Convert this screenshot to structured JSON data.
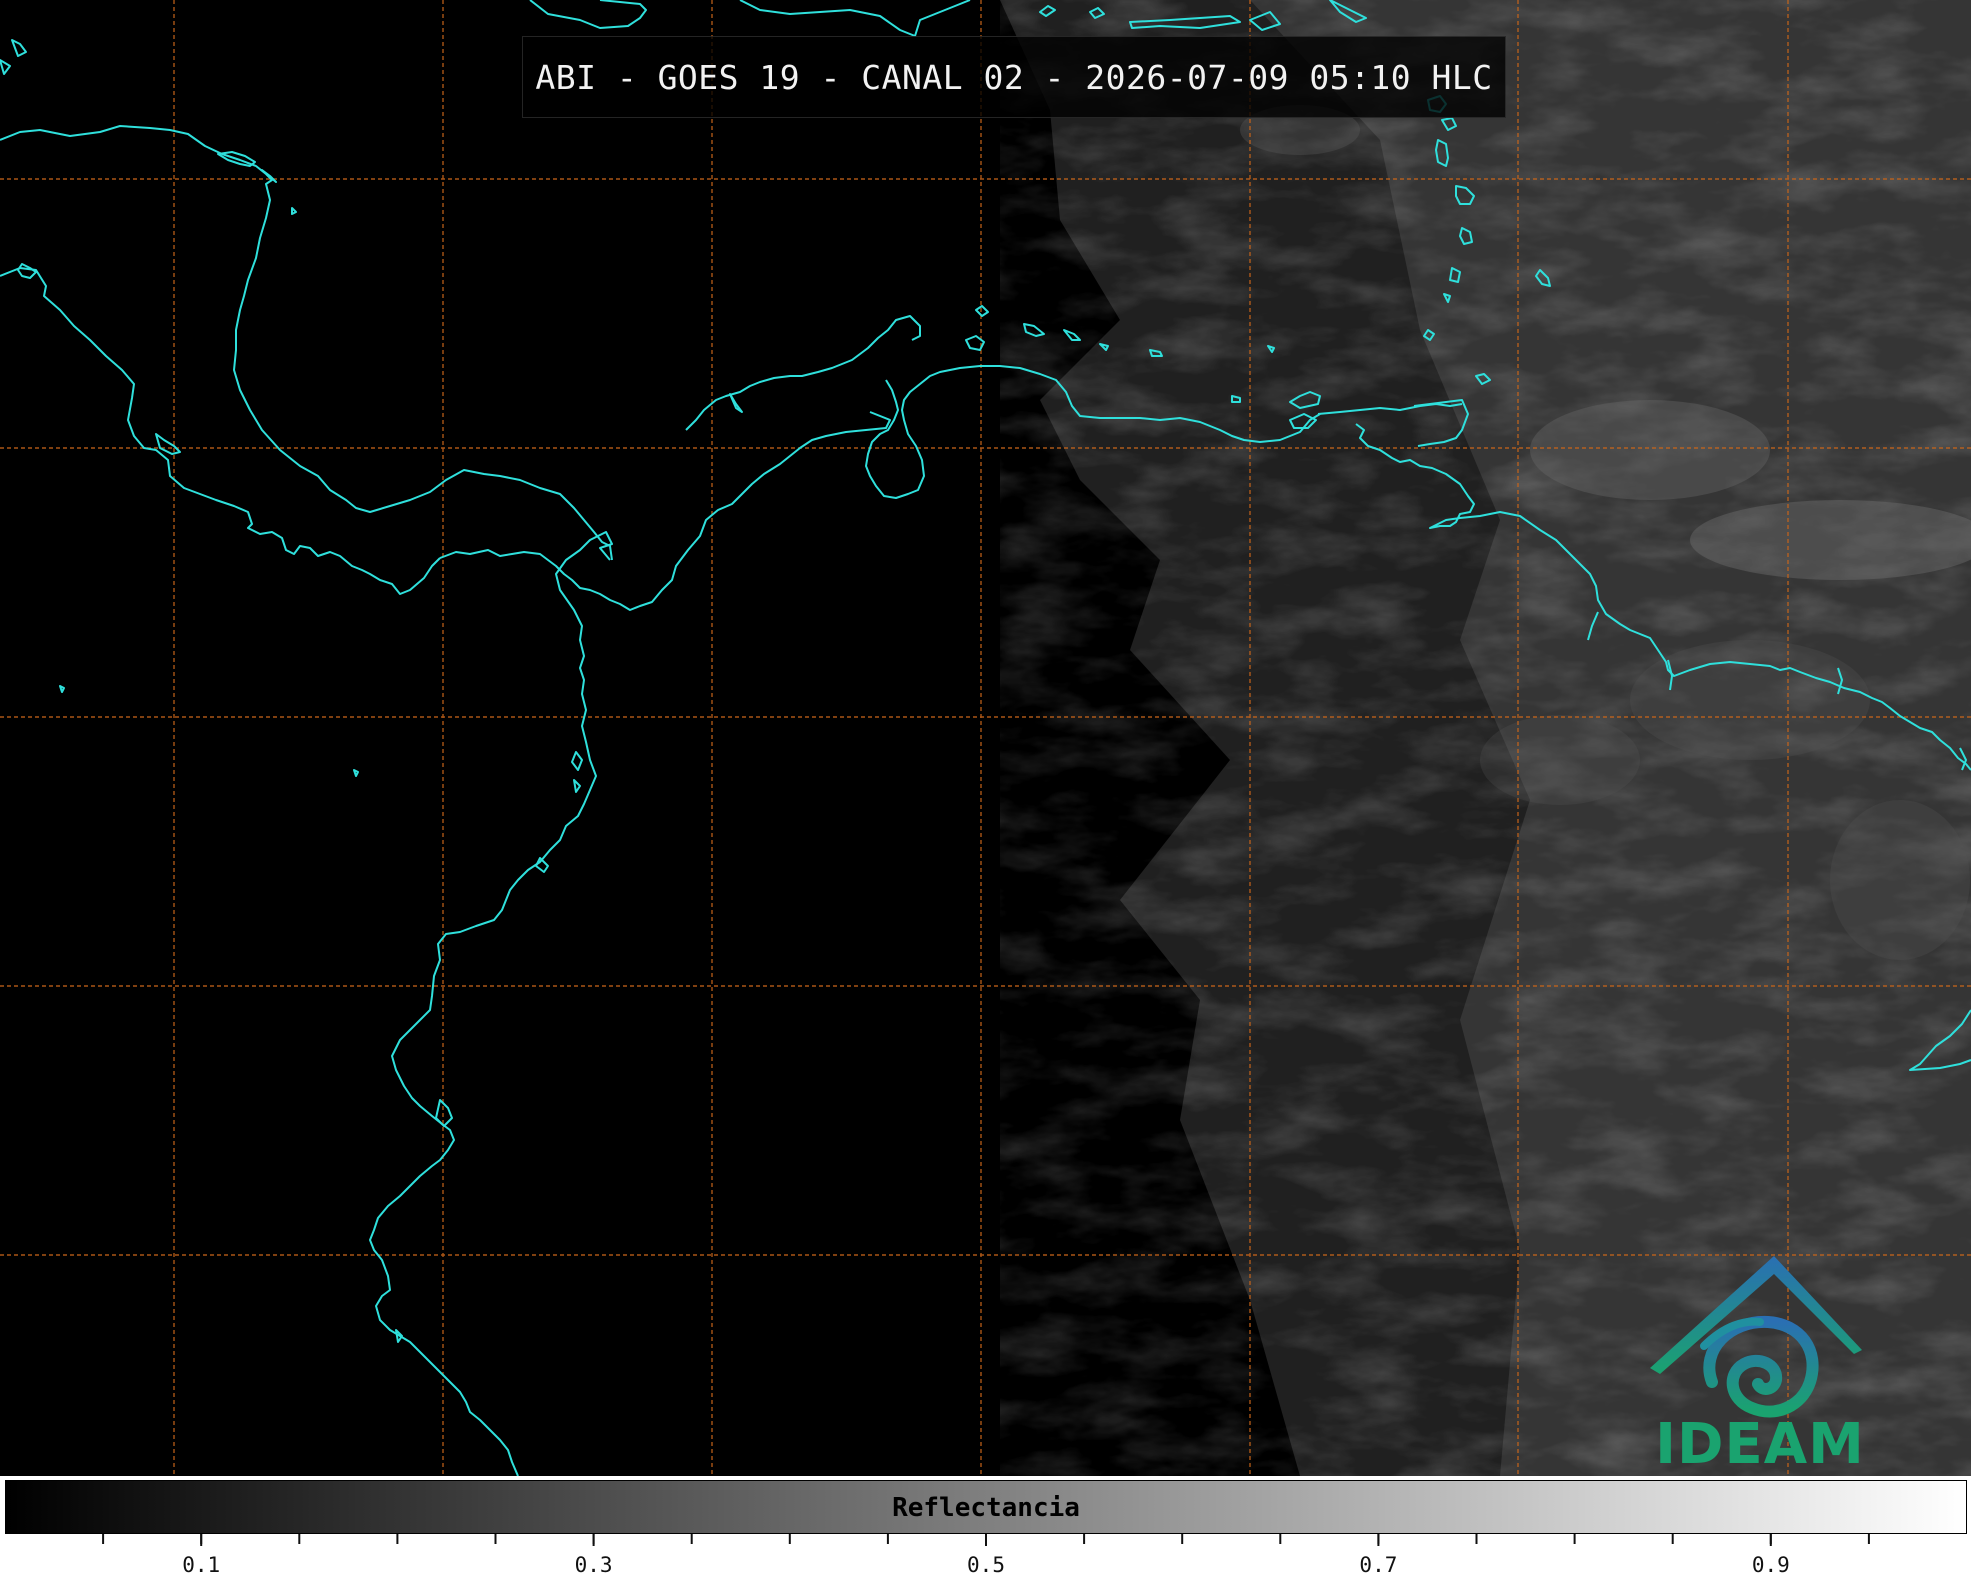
{
  "title": "ABI - GOES 19 - CANAL 02 - 2026-07-09 05:10 HLC",
  "logo": {
    "text": "IDEAM",
    "icon": "ideam-swirl-logo",
    "colors": {
      "top": "#2a6fb3",
      "bottom": "#1aa36f"
    }
  },
  "colorbar": {
    "label": "Reflectancia",
    "range": [
      0,
      1
    ],
    "tick_values": [
      0.1,
      0.3,
      0.5,
      0.7,
      0.9
    ],
    "tick_labels": [
      "0.1",
      "0.3",
      "0.5",
      "0.7",
      "0.9"
    ],
    "minor_tick_step": 0.05
  },
  "map": {
    "coastline_color": "#2fe0dc",
    "gridline_color": "#c8651a",
    "background_color": "#000000"
  }
}
